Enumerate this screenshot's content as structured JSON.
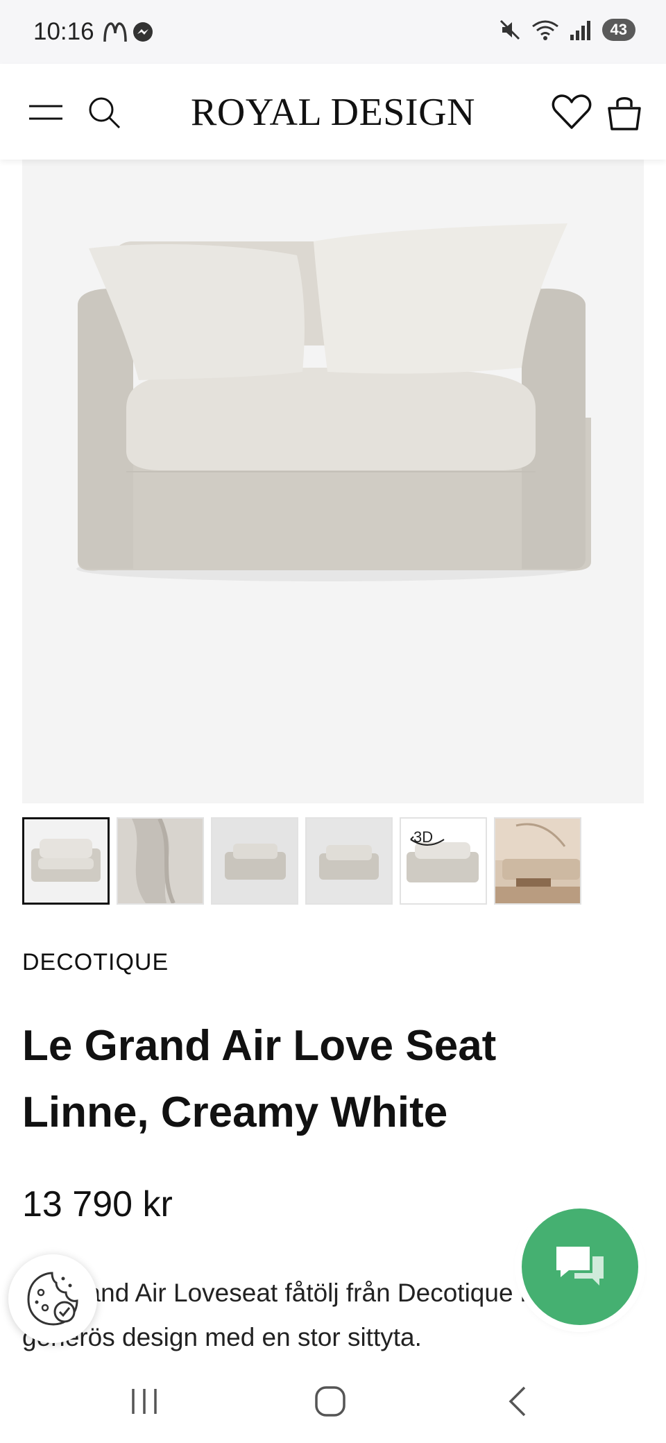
{
  "status": {
    "time": "10:16",
    "battery": "43",
    "icons_left": [
      "mcdonalds-icon",
      "messenger-icon"
    ],
    "icons_right": [
      "mute-icon",
      "wifi-icon",
      "signal-icon",
      "battery-icon"
    ]
  },
  "header": {
    "brand": "ROYAL DESIGN",
    "icons": [
      "menu-icon",
      "search-icon",
      "heart-icon",
      "bag-icon"
    ]
  },
  "gallery": {
    "thumbnails": [
      {
        "name": "thumbnail-front"
      },
      {
        "name": "thumbnail-fabric"
      },
      {
        "name": "thumbnail-angle"
      },
      {
        "name": "thumbnail-front-small"
      },
      {
        "name": "thumbnail-3d",
        "badge": "3D"
      },
      {
        "name": "thumbnail-room"
      }
    ]
  },
  "product": {
    "brand": "DECOTIQUE",
    "title": "Le Grand Air Love Seat Linne, Creamy White",
    "price": "13 790 kr",
    "description": "Le Grand Air Loveseat fåtölj från Decotique har en generös design med en stor sittyta."
  },
  "colors": {
    "chat_button": "#45b071",
    "text": "#111111",
    "image_background": "#f4f4f4"
  }
}
